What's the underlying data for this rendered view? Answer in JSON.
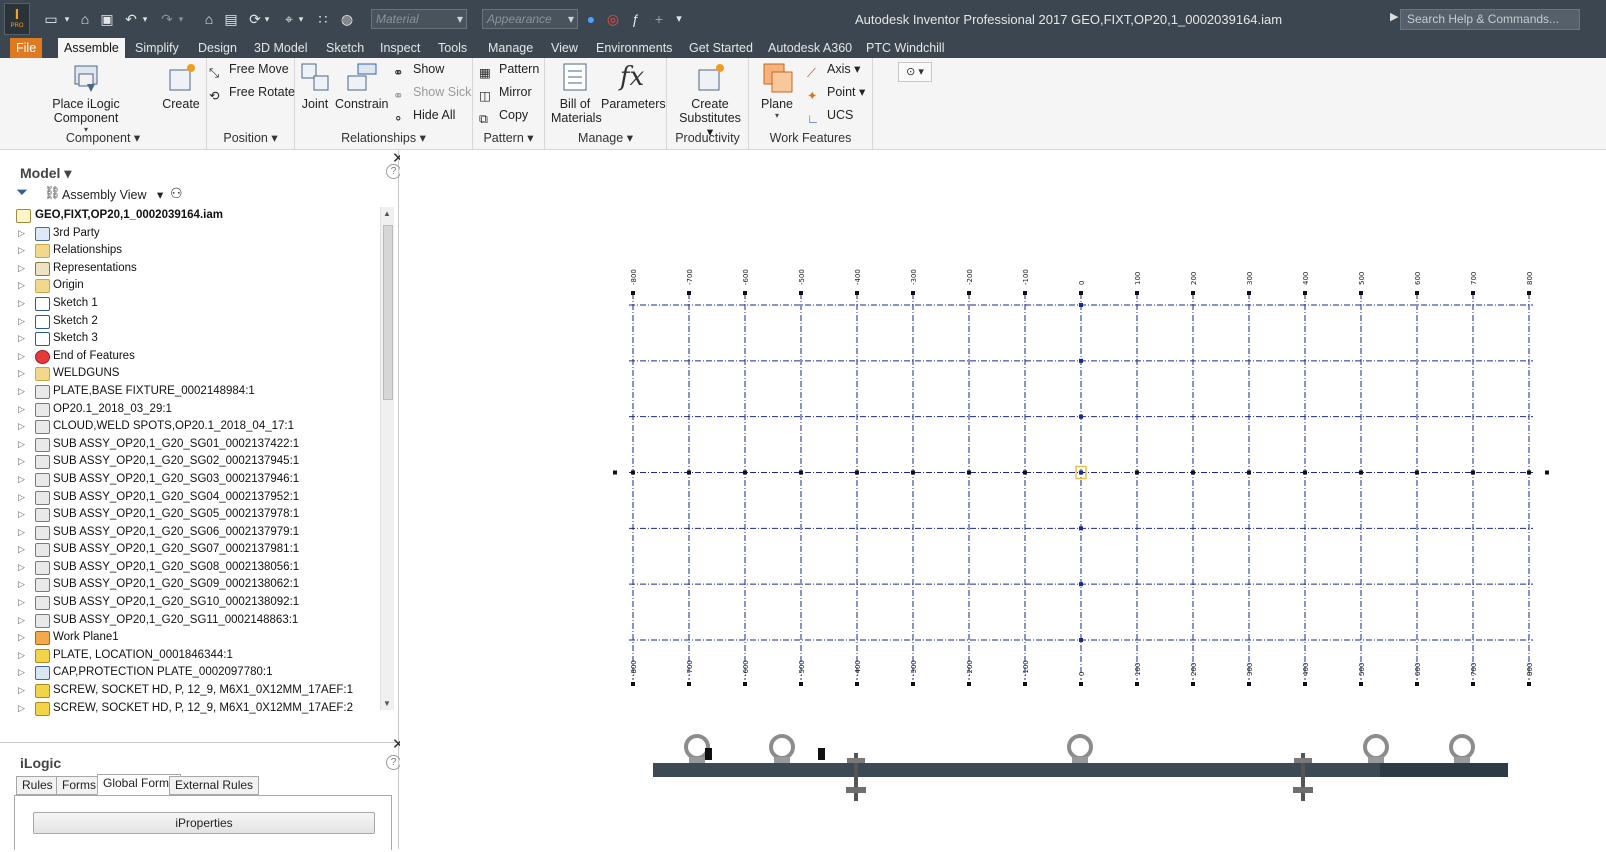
{
  "titlebar": {
    "logo_text": "I",
    "logo_sub": "PRO",
    "material_placeholder": "Material",
    "appearance_placeholder": "Appearance",
    "app_title": "Autodesk Inventor Professional 2017    GEO,FIXT,OP20,1_0002039164.iam",
    "search_placeholder": "Search Help & Commands..."
  },
  "tabs": [
    "File",
    "Assemble",
    "Simplify",
    "Design",
    "3D Model",
    "Sketch",
    "Inspect",
    "Tools",
    "Manage",
    "View",
    "Environments",
    "Get Started",
    "Autodesk A360",
    "PTC Windchill"
  ],
  "ribbon": {
    "component": {
      "title": "Component",
      "place": "Place iLogic Component",
      "create": "Create"
    },
    "position": {
      "title": "Position",
      "free_move": "Free Move",
      "free_rotate": "Free Rotate"
    },
    "relationships": {
      "title": "Relationships",
      "joint": "Joint",
      "constrain": "Constrain",
      "show": "Show",
      "show_sick": "Show Sick",
      "hide_all": "Hide All"
    },
    "pattern": {
      "title": "Pattern",
      "pattern": "Pattern",
      "mirror": "Mirror",
      "copy": "Copy"
    },
    "manage": {
      "title": "Manage",
      "bom_line1": "Bill of",
      "bom_line2": "Materials",
      "parameters": "Parameters"
    },
    "productivity": {
      "title": "Productivity",
      "create_sub_line1": "Create",
      "create_sub_line2": "Substitutes"
    },
    "work_features": {
      "title": "Work Features",
      "plane": "Plane",
      "axis": "Axis",
      "point": "Point",
      "ucs": "UCS"
    }
  },
  "model_panel": {
    "header": "Model",
    "view": "Assembly View",
    "tree": [
      {
        "label": "GEO,FIXT,OP20,1_0002039164.iam",
        "icon": "assembly-icon",
        "root": true
      },
      {
        "label": "3rd Party",
        "icon": "third-party-icon"
      },
      {
        "label": "Relationships",
        "icon": "folder-icon"
      },
      {
        "label": "Representations",
        "icon": "representations-icon"
      },
      {
        "label": "Origin",
        "icon": "folder-icon"
      },
      {
        "label": "Sketch 1",
        "icon": "sketch-icon"
      },
      {
        "label": "Sketch 2",
        "icon": "sketch-icon"
      },
      {
        "label": "Sketch 3",
        "icon": "sketch-icon"
      },
      {
        "label": "End of Features",
        "icon": "end-of-features-icon"
      },
      {
        "label": "WELDGUNS",
        "icon": "folder-icon"
      },
      {
        "label": "PLATE,BASE FIXTURE_0002148984:1",
        "icon": "subassembly-icon"
      },
      {
        "label": "OP20.1_2018_03_29:1",
        "icon": "subassembly-icon"
      },
      {
        "label": "CLOUD,WELD SPOTS,OP20.1_2018_04_17:1",
        "icon": "subassembly-icon"
      },
      {
        "label": "SUB ASSY_OP20,1_G20_SG01_0002137422:1",
        "icon": "subassembly-icon"
      },
      {
        "label": "SUB ASSY_OP20,1_G20_SG02_0002137945:1",
        "icon": "subassembly-icon"
      },
      {
        "label": "SUB ASSY_OP20,1_G20_SG03_0002137946:1",
        "icon": "subassembly-icon"
      },
      {
        "label": "SUB ASSY_OP20,1_G20_SG04_0002137952:1",
        "icon": "subassembly-icon"
      },
      {
        "label": "SUB ASSY_OP20,1_G20_SG05_0002137978:1",
        "icon": "subassembly-icon"
      },
      {
        "label": "SUB ASSY_OP20,1_G20_SG06_0002137979:1",
        "icon": "subassembly-icon"
      },
      {
        "label": "SUB ASSY_OP20,1_G20_SG07_0002137981:1",
        "icon": "subassembly-icon"
      },
      {
        "label": "SUB ASSY_OP20,1_G20_SG08_0002138056:1",
        "icon": "subassembly-icon"
      },
      {
        "label": "SUB ASSY_OP20,1_G20_SG09_0002138062:1",
        "icon": "subassembly-icon"
      },
      {
        "label": "SUB ASSY_OP20,1_G20_SG10_0002138092:1",
        "icon": "subassembly-icon"
      },
      {
        "label": "SUB ASSY_OP20,1_G20_SG11_0002148863:1",
        "icon": "subassembly-icon"
      },
      {
        "label": "Work Plane1",
        "icon": "work-plane-icon"
      },
      {
        "label": "PLATE, LOCATION_0001846344:1",
        "icon": "part-icon"
      },
      {
        "label": "CAP,PROTECTION PLATE_0002097780:1",
        "icon": "cap-icon"
      },
      {
        "label": "SCREW, SOCKET HD, P, 12_9, M6X1_0X12MM_17AEF:1",
        "icon": "part-icon"
      },
      {
        "label": "SCREW, SOCKET HD, P, 12_9, M6X1_0X12MM_17AEF:2",
        "icon": "part-icon"
      }
    ]
  },
  "ilogic": {
    "title": "iLogic",
    "tabs": [
      "Rules",
      "Forms",
      "Global Forms",
      "External Rules"
    ],
    "active_tab": "Global Forms",
    "button": "iProperties"
  },
  "canvas": {
    "grid_labels": [
      "-800",
      "-700",
      "-600",
      "-500",
      "-400",
      "-300",
      "-200",
      "-100",
      "0",
      "100",
      "200",
      "300",
      "400",
      "500",
      "600",
      "700",
      "800"
    ],
    "grid_color": "#1a2a8c",
    "plate_color": "#3c4a55"
  },
  "colors": {
    "titlebar_bg": "#3c4650",
    "file_tab": "#e07a1e",
    "ribbon_bg": "#f5f5f5"
  }
}
